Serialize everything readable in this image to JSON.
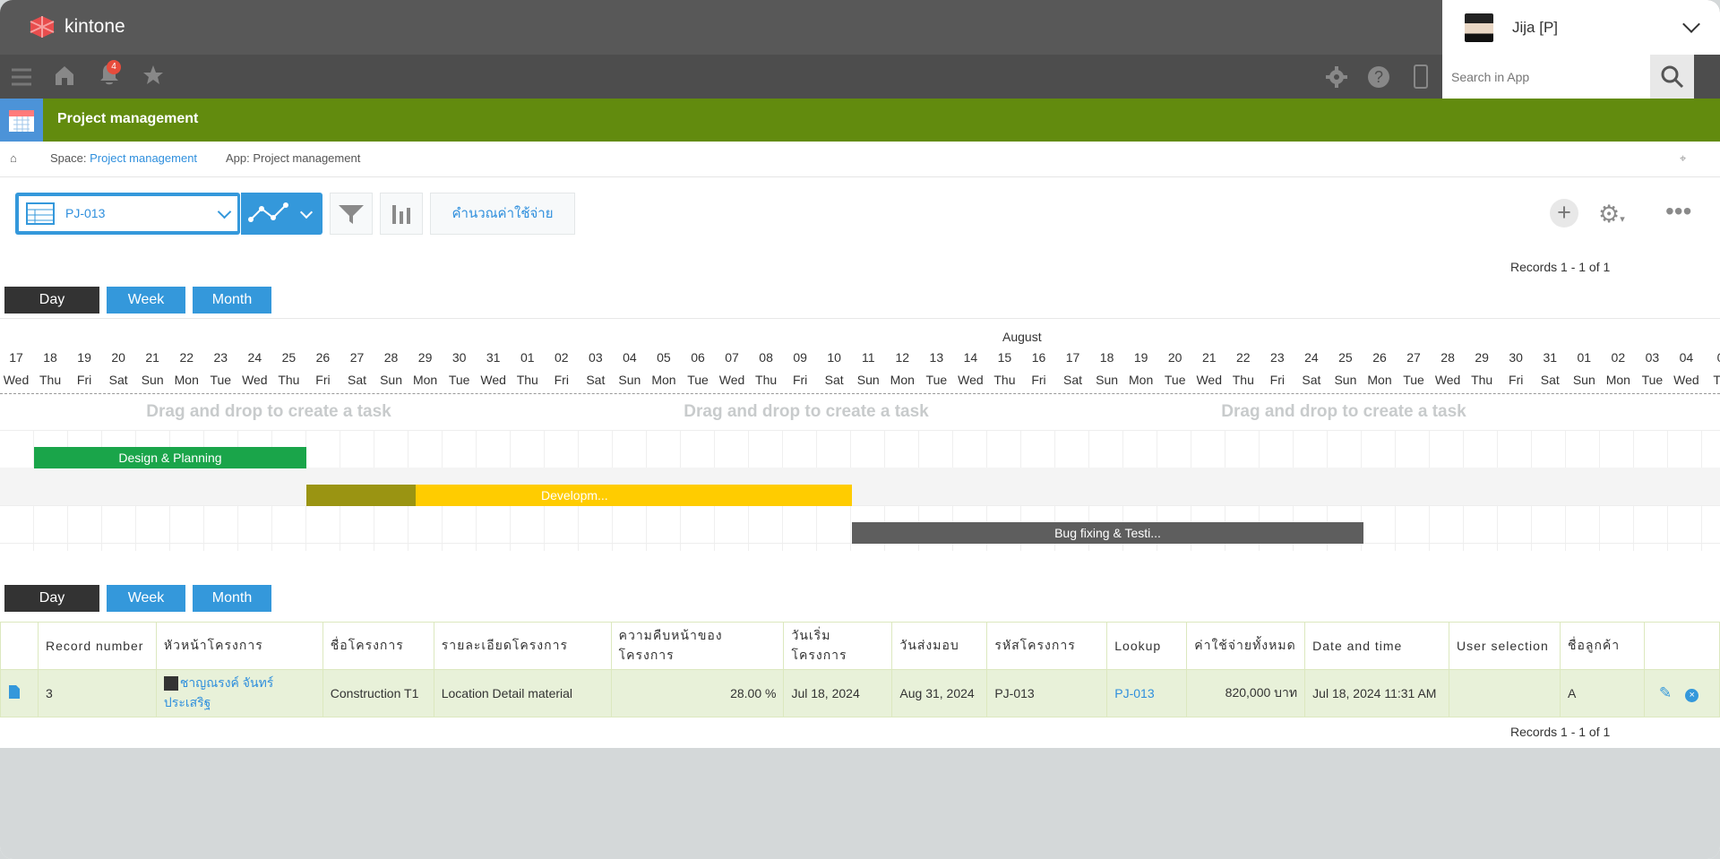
{
  "header": {
    "app_name": "kintone",
    "user_name": "Jija [P]",
    "notification_count": "4",
    "search_placeholder": "Search in App"
  },
  "app": {
    "title": "Project management"
  },
  "breadcrumb": {
    "space_prefix": "Space: ",
    "space_link": "Project management",
    "app_label": "App: Project management"
  },
  "toolbar": {
    "view_name": "PJ-013",
    "calculate_label": "คำนวณค่าใช้จ่าย"
  },
  "records_text": "Records 1 - 1 of 1",
  "scale_buttons": {
    "day": "Day",
    "week": "Week",
    "month": "Month"
  },
  "gantt": {
    "month_label": "August",
    "days": [
      "17",
      "18",
      "19",
      "20",
      "21",
      "22",
      "23",
      "24",
      "25",
      "26",
      "27",
      "28",
      "29",
      "30",
      "31",
      "01",
      "02",
      "03",
      "04",
      "05",
      "06",
      "07",
      "08",
      "09",
      "10",
      "11",
      "12",
      "13",
      "14",
      "15",
      "16",
      "17",
      "18",
      "19",
      "20",
      "21",
      "22",
      "23",
      "24",
      "25",
      "26",
      "27",
      "28",
      "29",
      "30",
      "31",
      "01",
      "02",
      "03",
      "04",
      "0"
    ],
    "weekdays": [
      "Wed",
      "Thu",
      "Fri",
      "Sat",
      "Sun",
      "Mon",
      "Tue",
      "Wed",
      "Thu",
      "Fri",
      "Sat",
      "Sun",
      "Mon",
      "Tue",
      "Wed",
      "Thu",
      "Fri",
      "Sat",
      "Sun",
      "Mon",
      "Tue",
      "Wed",
      "Thu",
      "Fri",
      "Sat",
      "Sun",
      "Mon",
      "Tue",
      "Wed",
      "Thu",
      "Fri",
      "Sat",
      "Sun",
      "Mon",
      "Tue",
      "Wed",
      "Thu",
      "Fri",
      "Sat",
      "Sun",
      "Mon",
      "Tue",
      "Wed",
      "Thu",
      "Fri",
      "Sat",
      "Sun",
      "Mon",
      "Tue",
      "Wed",
      "Th"
    ],
    "drag_hint": "Drag and drop to create a task",
    "tasks": [
      {
        "name": "Design & Planning",
        "color": "#1aa54a"
      },
      {
        "name": "Developm...",
        "color": "#ffcc00",
        "progress_color": "#9a9412"
      },
      {
        "name": "Bug fixing & Testi...",
        "color": "#5e5e5e"
      }
    ]
  },
  "table": {
    "headers": [
      "Record number",
      "หัวหน้าโครงการ",
      "ชื่อโครงการ",
      "รายละเอียดโครงการ",
      "ความคืบหน้าของโครงการ",
      "วันเริ่มโครงการ",
      "วันส่งมอบ",
      "รหัสโครงการ",
      "Lookup",
      "ค่าใช้จ่ายทั้งหมด",
      "Date and time",
      "User selection",
      "ชื่อลูกค้า"
    ],
    "row": {
      "record_number": "3",
      "leader": "ชาญณรงค์ จันทร์ประเสริฐ",
      "project_name": "Construction T1",
      "project_detail": "Location Detail material",
      "progress": "28.00 %",
      "start_date": "Jul 18, 2024",
      "delivery_date": "Aug 31, 2024",
      "project_code": "PJ-013",
      "lookup": "PJ-013",
      "total_cost": "820,000 บาท",
      "date_time": "Jul 18, 2024 11:31 AM",
      "user_selection": "",
      "customer": "A"
    }
  }
}
